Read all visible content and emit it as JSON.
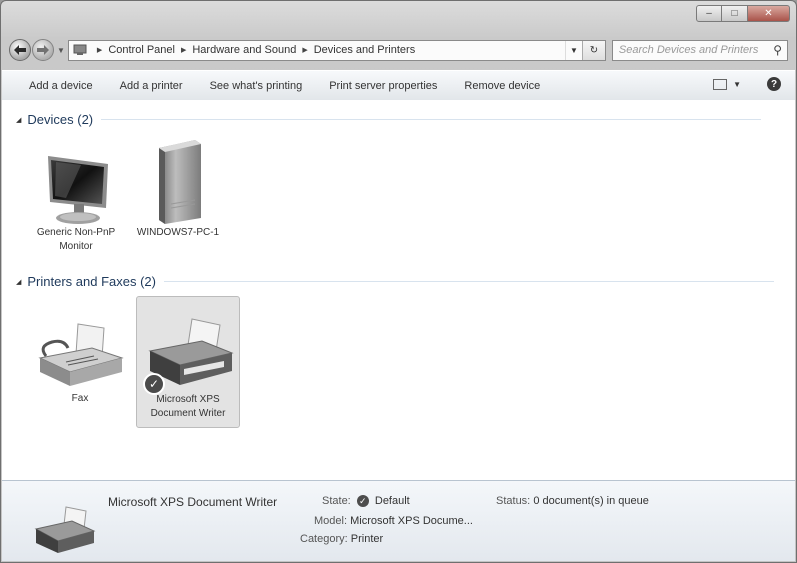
{
  "window": {
    "caption_buttons": {
      "minimize": "–",
      "maximize": "□",
      "close": "✕"
    }
  },
  "nav": {
    "back_icon": "arrow-left-icon",
    "forward_icon": "arrow-right-icon",
    "breadcrumb": [
      "Control Panel",
      "Hardware and Sound",
      "Devices and Printers"
    ],
    "refresh_glyph": "↻",
    "search_placeholder": "Search Devices and Printers"
  },
  "toolbar": {
    "items": [
      "Add a device",
      "Add a printer",
      "See what's printing",
      "Print server properties",
      "Remove device"
    ]
  },
  "groups": {
    "devices": {
      "title": "Devices (2)"
    },
    "printers": {
      "title": "Printers and Faxes (2)"
    }
  },
  "devices": [
    {
      "label": "Generic Non-PnP Monitor",
      "icon": "monitor-icon"
    },
    {
      "label": "WINDOWS7-PC-1",
      "icon": "computer-tower-icon"
    }
  ],
  "printers": [
    {
      "label": "Fax",
      "icon": "fax-icon",
      "selected": false
    },
    {
      "label": "Microsoft XPS Document Writer",
      "icon": "printer-icon",
      "selected": true
    }
  ],
  "details": {
    "name": "Microsoft XPS Document Writer",
    "state_label": "State:",
    "state_value": "Default",
    "model_label": "Model:",
    "model_value": "Microsoft XPS Docume...",
    "category_label": "Category:",
    "category_value": "Printer",
    "status_label": "Status:",
    "status_value": "0 document(s) in queue"
  }
}
